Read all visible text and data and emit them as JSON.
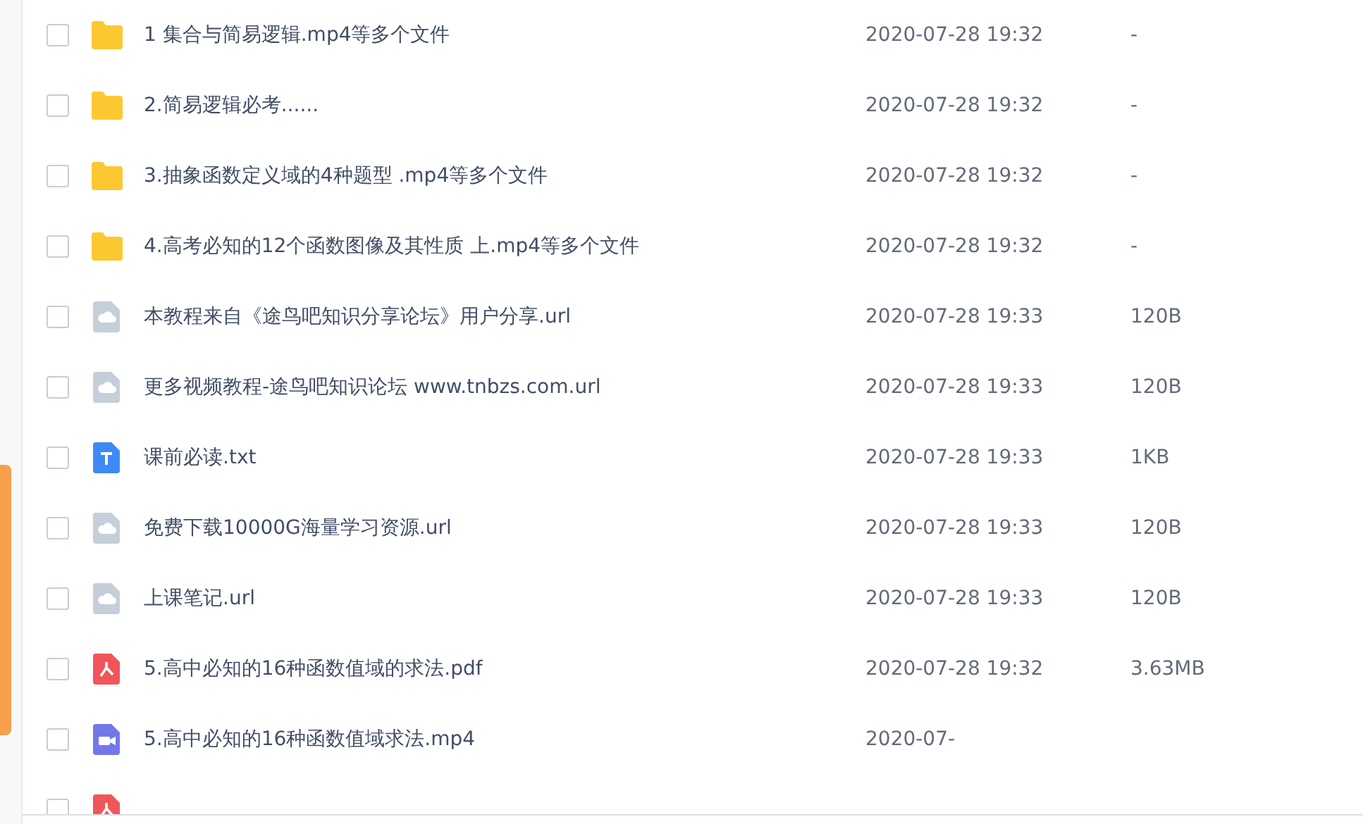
{
  "files": [
    {
      "kind": "folder",
      "name": "1 集合与简易逻辑.mp4等多个文件",
      "date": "2020-07-28 19:32",
      "size": "-",
      "checked": false
    },
    {
      "kind": "folder",
      "name": "2.简易逻辑必考......",
      "date": "2020-07-28 19:32",
      "size": "-",
      "checked": false
    },
    {
      "kind": "folder",
      "name": "3.抽象函数定义域的4种题型 .mp4等多个文件",
      "date": "2020-07-28 19:32",
      "size": "-",
      "checked": false
    },
    {
      "kind": "folder",
      "name": "4.高考必知的12个函数图像及其性质 上.mp4等多个文件",
      "date": "2020-07-28 19:32",
      "size": "-",
      "checked": false
    },
    {
      "kind": "link",
      "name": "本教程来自《途鸟吧知识分享论坛》用户分享.url",
      "date": "2020-07-28 19:33",
      "size": "120B",
      "checked": false
    },
    {
      "kind": "link",
      "name": "更多视频教程-途鸟吧知识论坛 www.tnbzs.com.url",
      "date": "2020-07-28 19:33",
      "size": "120B",
      "checked": false
    },
    {
      "kind": "text",
      "name": "课前必读.txt",
      "date": "2020-07-28 19:33",
      "size": "1KB",
      "checked": false
    },
    {
      "kind": "link",
      "name": "免费下载10000G海量学习资源.url",
      "date": "2020-07-28 19:33",
      "size": "120B",
      "checked": false
    },
    {
      "kind": "link",
      "name": "上课笔记.url",
      "date": "2020-07-28 19:33",
      "size": "120B",
      "checked": false
    },
    {
      "kind": "pdf",
      "name": "5.高中必知的16种函数值域的求法.pdf",
      "date": "2020-07-28 19:32",
      "size": "3.63MB",
      "checked": false
    },
    {
      "kind": "video",
      "name": "5.高中必知的16种函数值域求法.mp4",
      "date": "2020-07-",
      "checked": false
    },
    {
      "kind": "pdf",
      "checked": false
    }
  ]
}
